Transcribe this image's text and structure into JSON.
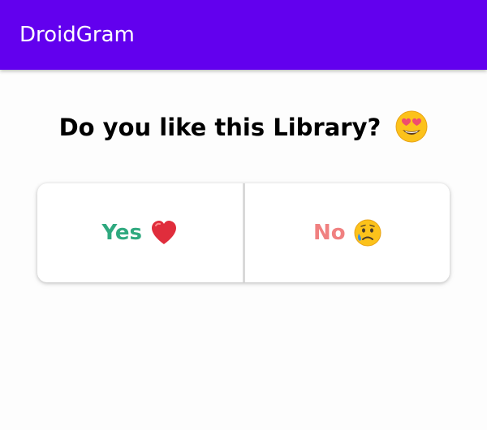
{
  "app": {
    "title": "DroidGram",
    "colors": {
      "toolbar": "#6200ee",
      "yes": "#2fa97f",
      "no": "#f08080"
    }
  },
  "question": {
    "text": "Do you like this Library?",
    "emoji": "heart-eyes-emoji-icon"
  },
  "choices": {
    "yes": {
      "label": "Yes",
      "icon": "red-heart-icon"
    },
    "no": {
      "label": "No",
      "icon": "sad-tear-face-icon"
    }
  }
}
